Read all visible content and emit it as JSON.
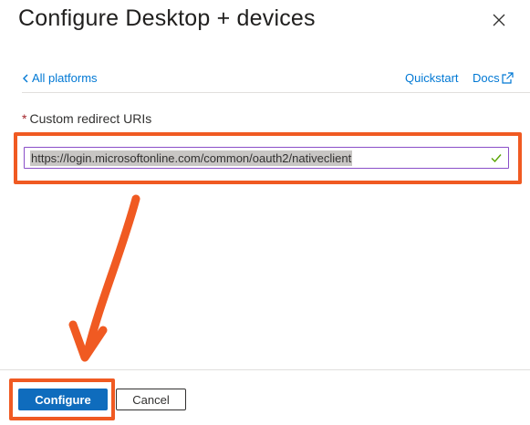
{
  "header": {
    "title": "Configure Desktop + devices",
    "close_icon": "close-icon"
  },
  "nav": {
    "back_label": "All platforms",
    "quickstart_label": "Quickstart",
    "docs_label": "Docs"
  },
  "form": {
    "required_marker": "*",
    "label": "Custom redirect URIs",
    "uri_value": "https://login.microsoftonline.com/common/oauth2/nativeclient",
    "valid_icon": "checkmark-icon"
  },
  "footer": {
    "configure_label": "Configure",
    "cancel_label": "Cancel"
  },
  "colors": {
    "accent": "#0f6cbd",
    "link": "#0078d4",
    "annotation": "#f05a22",
    "valid": "#57a300",
    "required": "#a4262c"
  }
}
